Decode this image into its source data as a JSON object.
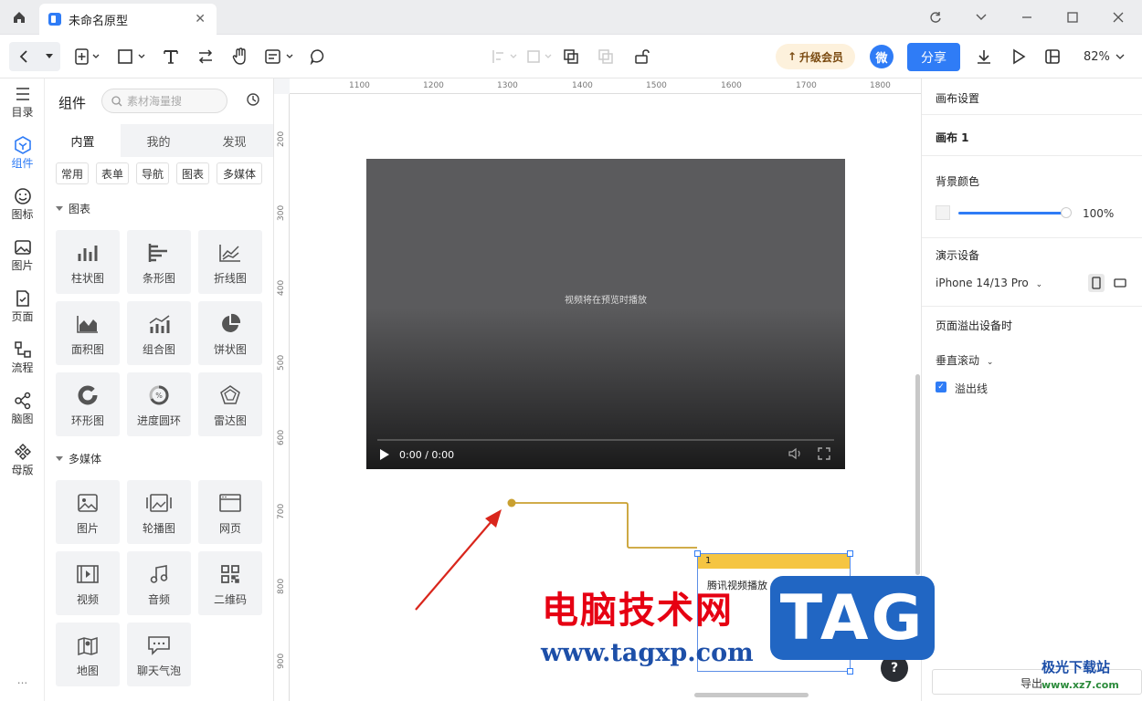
{
  "titlebar": {
    "tab_title": "未命名原型",
    "close": "✕"
  },
  "toolbar": {
    "vip_label": "升级会员",
    "avatar_label": "微",
    "share_label": "分享",
    "zoom_label": "82%"
  },
  "leftnav": {
    "items": [
      {
        "label": "目录",
        "icon": "list-icon"
      },
      {
        "label": "组件",
        "icon": "component-icon"
      },
      {
        "label": "图标",
        "icon": "smiley-icon"
      },
      {
        "label": "图片",
        "icon": "image-icon"
      },
      {
        "label": "页面",
        "icon": "page-icon"
      },
      {
        "label": "流程",
        "icon": "flow-icon"
      },
      {
        "label": "脑图",
        "icon": "mindmap-icon"
      },
      {
        "label": "母版",
        "icon": "master-icon"
      }
    ],
    "more": "..."
  },
  "panel": {
    "title": "组件",
    "search_placeholder": "素材海量搜",
    "tabs": [
      "内置",
      "我的",
      "发现"
    ],
    "chips": [
      "常用",
      "表单",
      "导航",
      "图表",
      "多媒体"
    ],
    "section_chart": "图表",
    "chart_items": [
      "柱状图",
      "条形图",
      "折线图",
      "面积图",
      "组合图",
      "饼状图",
      "环形图",
      "进度圆环",
      "雷达图"
    ],
    "section_media": "多媒体",
    "media_items": [
      "图片",
      "轮播图",
      "网页",
      "视频",
      "音频",
      "二维码",
      "地图",
      "聊天气泡"
    ]
  },
  "ruler": {
    "h": [
      "1100",
      "1200",
      "1300",
      "1400",
      "1500",
      "1600",
      "1700",
      "1800"
    ],
    "v": [
      "200",
      "300",
      "400",
      "500",
      "600",
      "700",
      "800",
      "900"
    ]
  },
  "canvas": {
    "video_message": "视频将在预览时播放",
    "video_time": "0:00 / 0:00",
    "note_number": "1",
    "note_text": "腾讯视频播放",
    "help": "?"
  },
  "right": {
    "canvas_settings": "画布设置",
    "canvas_name": "画布 1",
    "bg_color_label": "背景颜色",
    "bg_opacity": "100%",
    "device_label": "演示设备",
    "device_value": "iPhone 14/13 Pro",
    "overflow_label": "页面溢出设备时",
    "scroll_value": "垂直滚动",
    "overflow_line": "溢出线",
    "export": "导出"
  },
  "watermark": {
    "text1": "电脑技术网",
    "text2": "www.tagxp.com",
    "tag": "TAG",
    "site1": "极光下载站",
    "site2": "www.xz7.com"
  },
  "colors": {
    "accent": "#2f7cf6",
    "note_header": "#f5c542",
    "connector": "#c9a030",
    "arrow": "#d9261c"
  }
}
